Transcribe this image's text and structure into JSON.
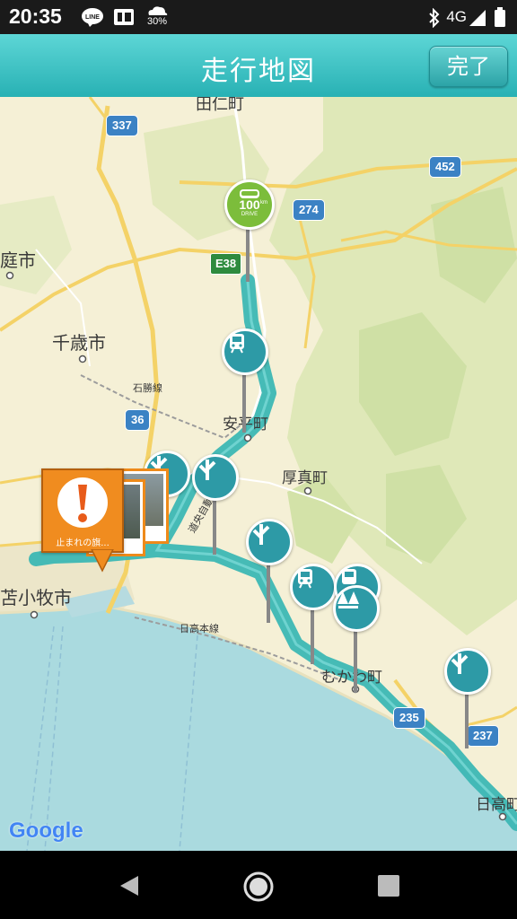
{
  "status_bar": {
    "time": "20:35",
    "line_badge": "LINE",
    "weather_text": "30%",
    "network": "4G"
  },
  "header": {
    "title": "走行地図",
    "done_label": "完了"
  },
  "map": {
    "places": {
      "tanitocho": "田仁町",
      "teishi": "庭市",
      "chitose": "千歳市",
      "abira": "安平町",
      "atsuma": "厚真町",
      "tomakomai": "苫小牧市",
      "mukawa": "むかわ町",
      "hidaka": "日高町",
      "sekisho_line": "石勝線",
      "hidaka_line": "日高本線",
      "expressway": "道央自動車道"
    },
    "shields": {
      "r337": "337",
      "r452": "452",
      "r274": "274",
      "e38": "E38",
      "r36": "36",
      "r235": "235",
      "r237": "237"
    },
    "milestone_badge": {
      "value": "100",
      "unit": "km",
      "sub": "DRIVE"
    },
    "flag_label": "止まれの旗...",
    "google_logo": "Google"
  }
}
